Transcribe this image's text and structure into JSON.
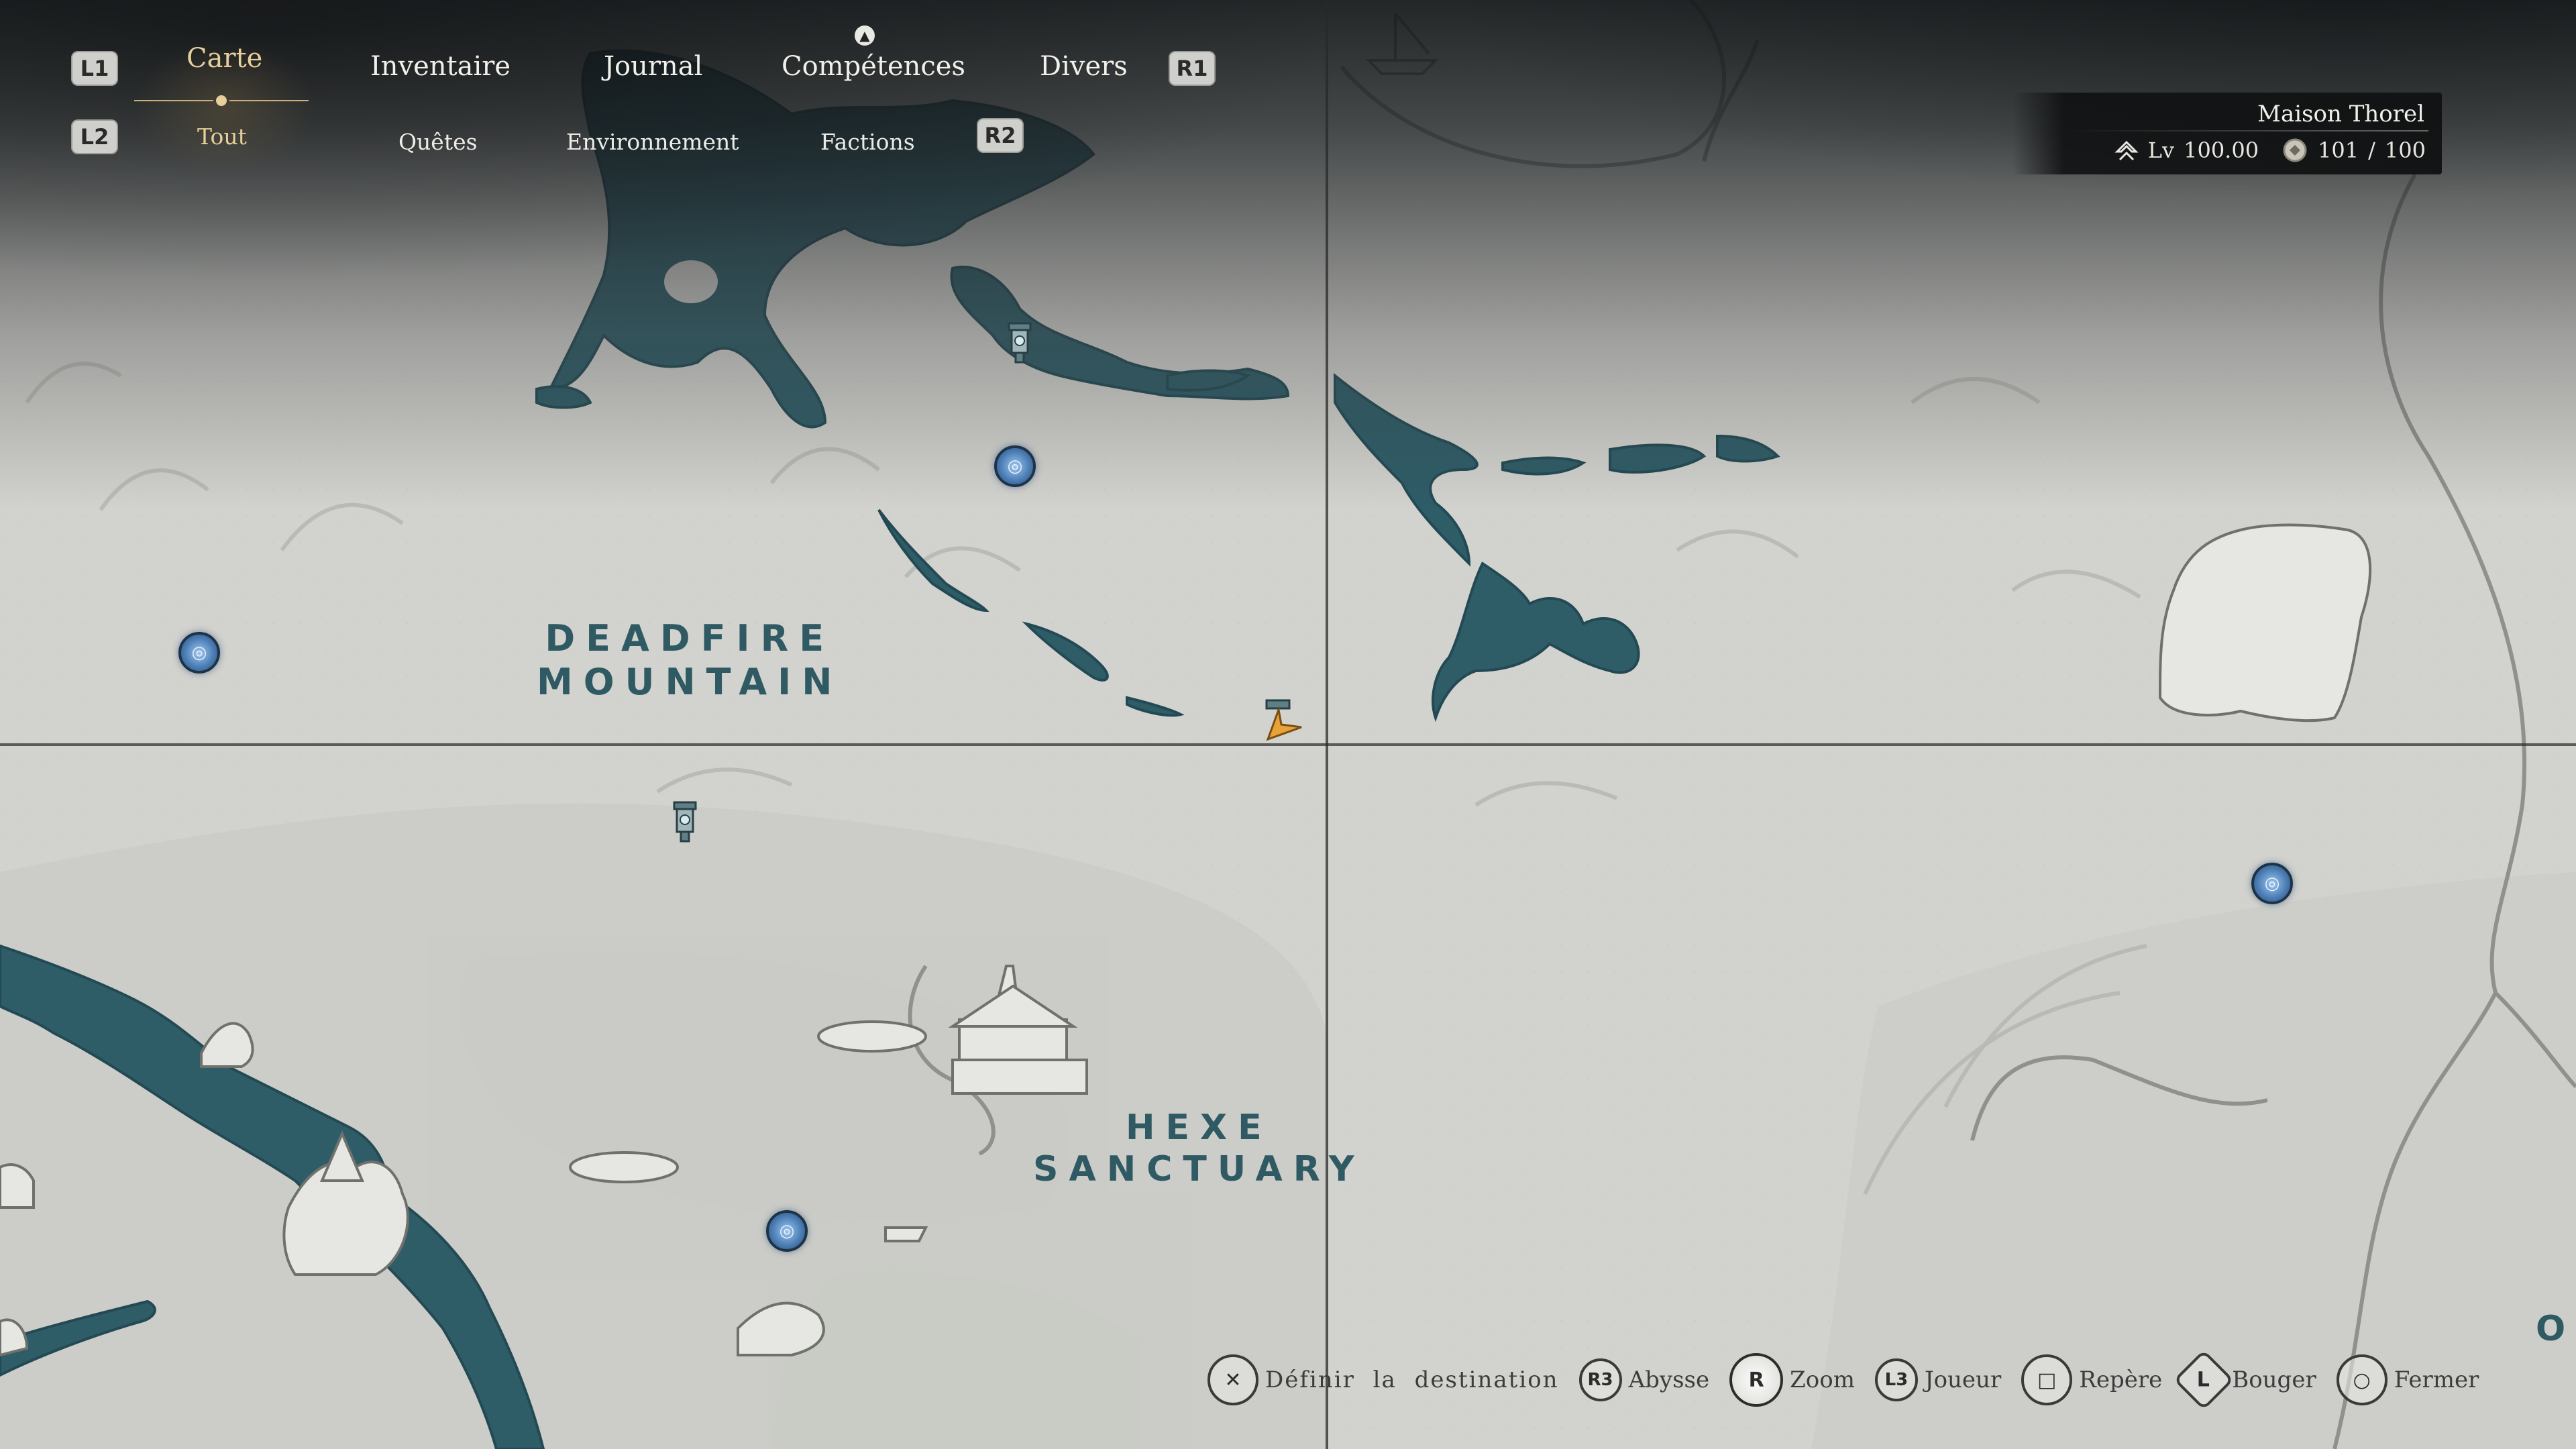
{
  "nav": {
    "l1": "L1",
    "r1": "R1",
    "l2": "L2",
    "r2": "R2",
    "triangle_icon": "triangle-button-icon",
    "tabs": [
      {
        "label": "Carte",
        "active": true
      },
      {
        "label": "Inventaire",
        "active": false
      },
      {
        "label": "Journal",
        "active": false
      },
      {
        "label": "Compétences",
        "active": false
      },
      {
        "label": "Divers",
        "active": false
      }
    ],
    "subtabs": [
      {
        "label": "Tout",
        "active": true
      },
      {
        "label": "Quêtes",
        "active": false
      },
      {
        "label": "Environnement",
        "active": false
      },
      {
        "label": "Factions",
        "active": false
      }
    ]
  },
  "info_panel": {
    "name": "Maison Thorel",
    "level_label": "Lv",
    "level_value": "100.00",
    "count_value": "101",
    "count_sep": "/",
    "count_max": "100",
    "level_icon": "rank-chevron-icon",
    "count_icon": "seal-icon"
  },
  "map": {
    "labels": {
      "deadfire_line1": "DEADFIRE",
      "deadfire_line2": "MOUNTAIN",
      "hexe_line1": "HEXE",
      "hexe_line2": "SANCTUARY",
      "edge_fragment": "O"
    },
    "colors": {
      "paper": "#d2d2ce",
      "water": "#2e5c67",
      "marker_blue": "#4d7fb7",
      "player": "#e8a23a"
    }
  },
  "hints": [
    {
      "button": "✕",
      "icon": "cross-button-icon",
      "label": "Définir la destination"
    },
    {
      "button": "R3",
      "icon": "r3-stick-icon",
      "label": "Abysse"
    },
    {
      "button": "R",
      "icon": "r-stick-zoom-icon",
      "label": "Zoom"
    },
    {
      "button": "L3",
      "icon": "l3-stick-icon",
      "label": "Joueur"
    },
    {
      "button": "□",
      "icon": "square-button-icon",
      "label": "Repère"
    },
    {
      "button": "L",
      "icon": "l-stick-icon",
      "label": "Bouger"
    },
    {
      "button": "○",
      "icon": "circle-button-icon",
      "label": "Fermer"
    }
  ]
}
